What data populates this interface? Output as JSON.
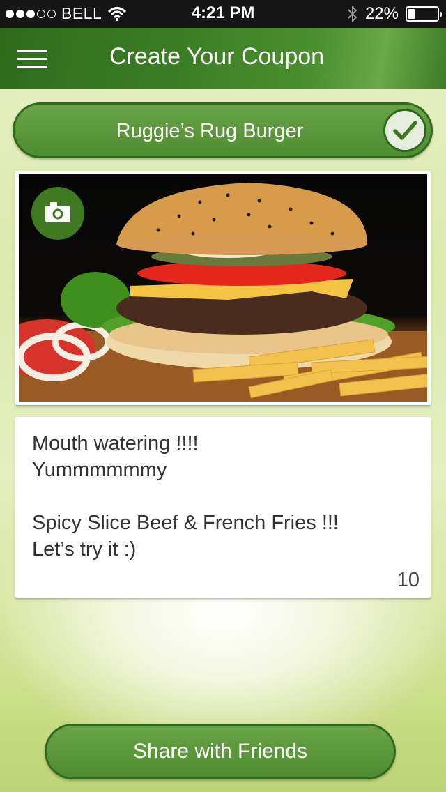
{
  "status_bar": {
    "carrier": "BELL",
    "signal_filled": 3,
    "signal_total": 5,
    "time": "4:21 PM",
    "battery_percent": "22%",
    "battery_level": 0.22
  },
  "header": {
    "title": "Create Your Coupon",
    "menu_icon": "hamburger-menu-icon"
  },
  "coupon": {
    "name": "Ruggie’s Rug Burger",
    "confirm_icon": "checkmark-icon",
    "photo_icon": "camera-icon",
    "photo_alt": "burger-and-fries-photo"
  },
  "message": {
    "line1": "Mouth watering !!!!",
    "line2": "Yummmmmmy",
    "line3": "Spicy Slice Beef & French Fries !!!",
    "line4": "Let’s try it :)",
    "char_count": "10"
  },
  "actions": {
    "share_label": "Share with Friends"
  },
  "colors": {
    "brand_green": "#4f8b31",
    "brand_dark_green": "#2f6a1b",
    "status_bar_bg": "#161616"
  }
}
